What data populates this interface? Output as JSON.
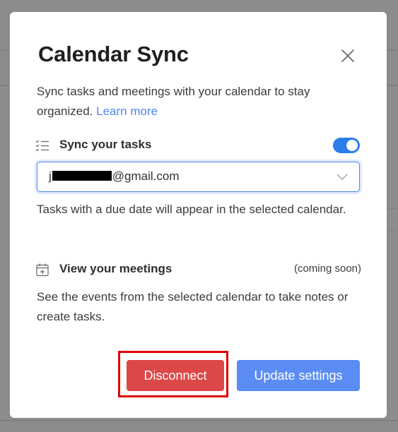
{
  "modal": {
    "title": "Calendar Sync",
    "description": "Sync tasks and meetings with your calendar to stay organized.",
    "learn_more": "Learn more"
  },
  "tasks": {
    "label": "Sync your tasks",
    "icon": "checklist-icon",
    "toggle_on": true,
    "calendar_select": {
      "value_prefix": "j",
      "value_suffix": "@gmail.com",
      "redacted": true
    },
    "helper": "Tasks with a due date will appear in the selected calendar."
  },
  "meetings": {
    "label": "View your meetings",
    "icon": "calendar-add-icon",
    "status": "(coming soon)",
    "description": "See the events from the selected calendar to take notes or create tasks."
  },
  "buttons": {
    "disconnect": "Disconnect",
    "update": "Update settings"
  },
  "colors": {
    "accent": "#2b7de9",
    "link": "#4e86f0",
    "danger": "#dc4848",
    "primary": "#5b8cf3",
    "highlight": "#e00000"
  }
}
